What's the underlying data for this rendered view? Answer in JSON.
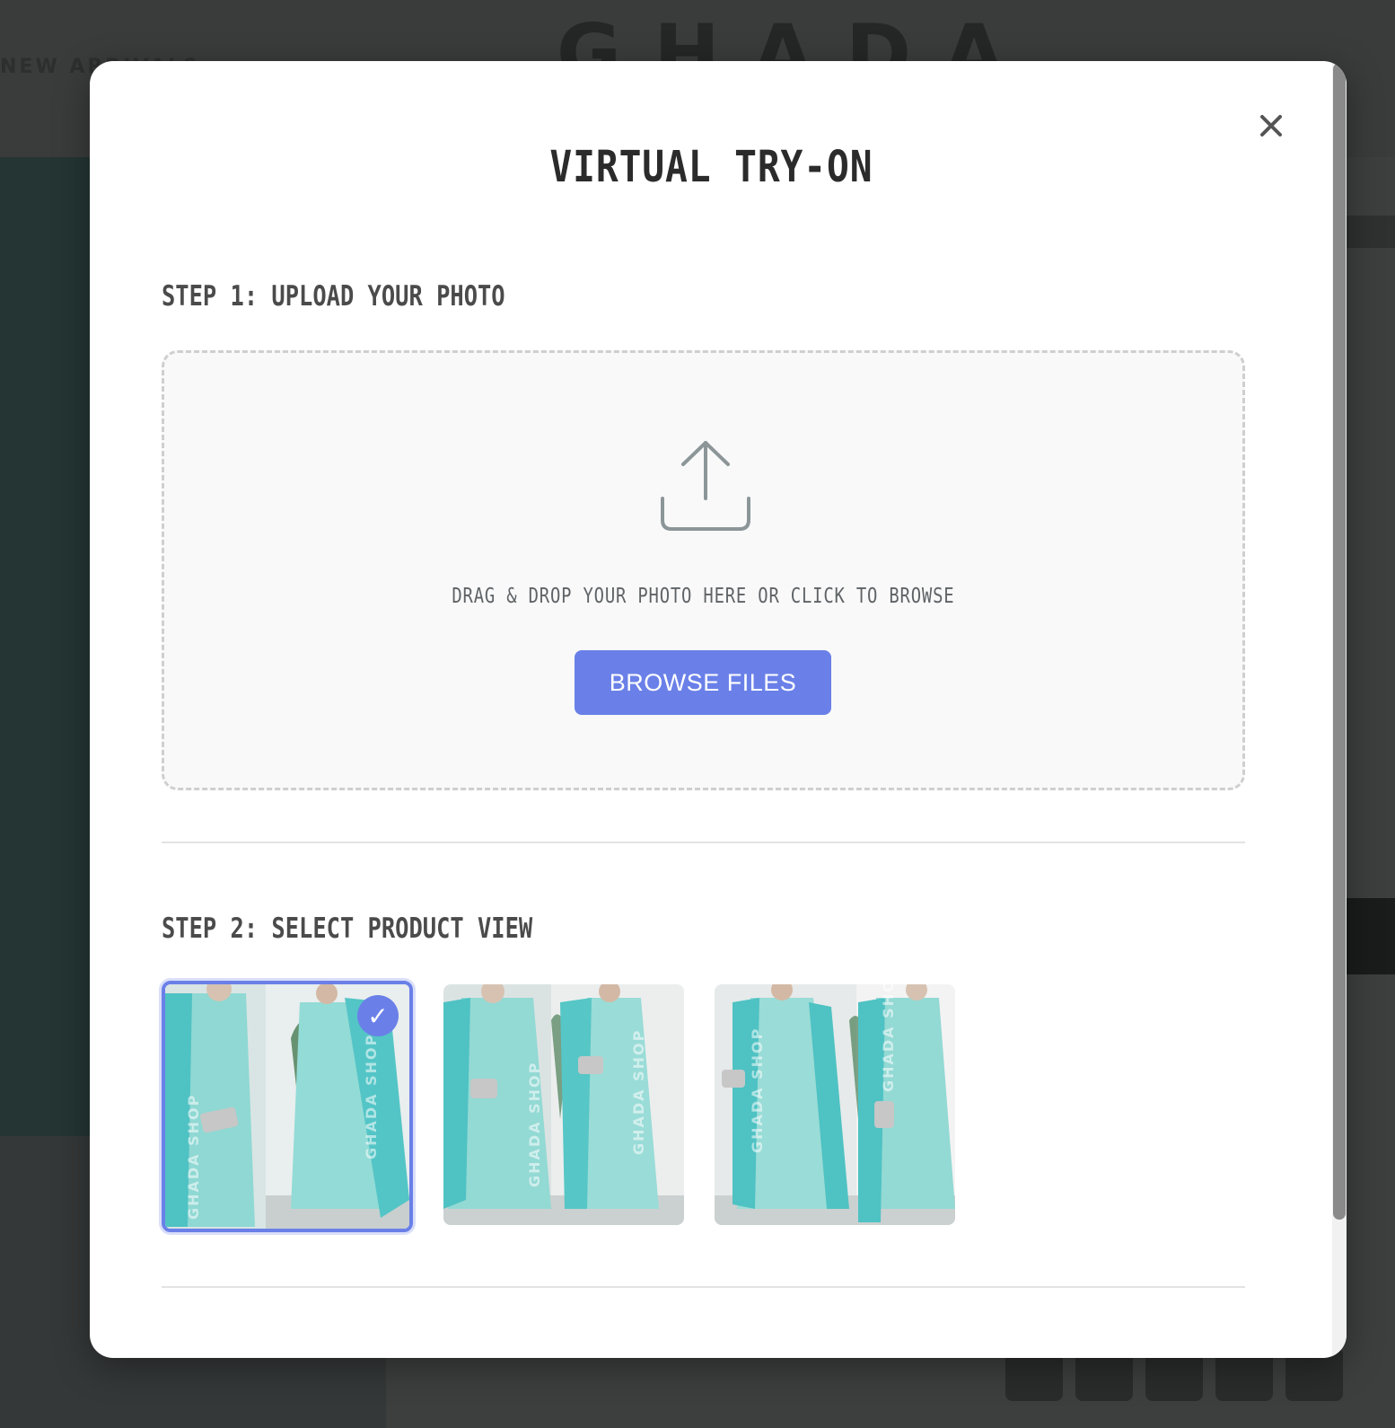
{
  "background": {
    "logo": "GHADA",
    "nav_text": "NEW ARRIVALS"
  },
  "modal": {
    "title": "VIRTUAL TRY-ON",
    "close_icon": "close-icon"
  },
  "step1": {
    "heading": "STEP 1: UPLOAD YOUR PHOTO",
    "upload_icon": "upload-icon",
    "drop_text": "DRAG & DROP YOUR PHOTO HERE OR CLICK TO BROWSE",
    "browse_label": "BROWSE FILES"
  },
  "step2": {
    "heading": "STEP 2: SELECT PRODUCT VIEW",
    "views": [
      {
        "watermark": "GHADA SHOP",
        "selected": true
      },
      {
        "watermark": "GHADA SHOP",
        "selected": false
      },
      {
        "watermark": "GHADA SHOP",
        "selected": false
      }
    ],
    "check_glyph": "✓"
  },
  "colors": {
    "accent": "#6a80e8",
    "dress": "#7fd3cf",
    "cape": "#4ec0c4",
    "overlay": "#3d3e3e"
  }
}
